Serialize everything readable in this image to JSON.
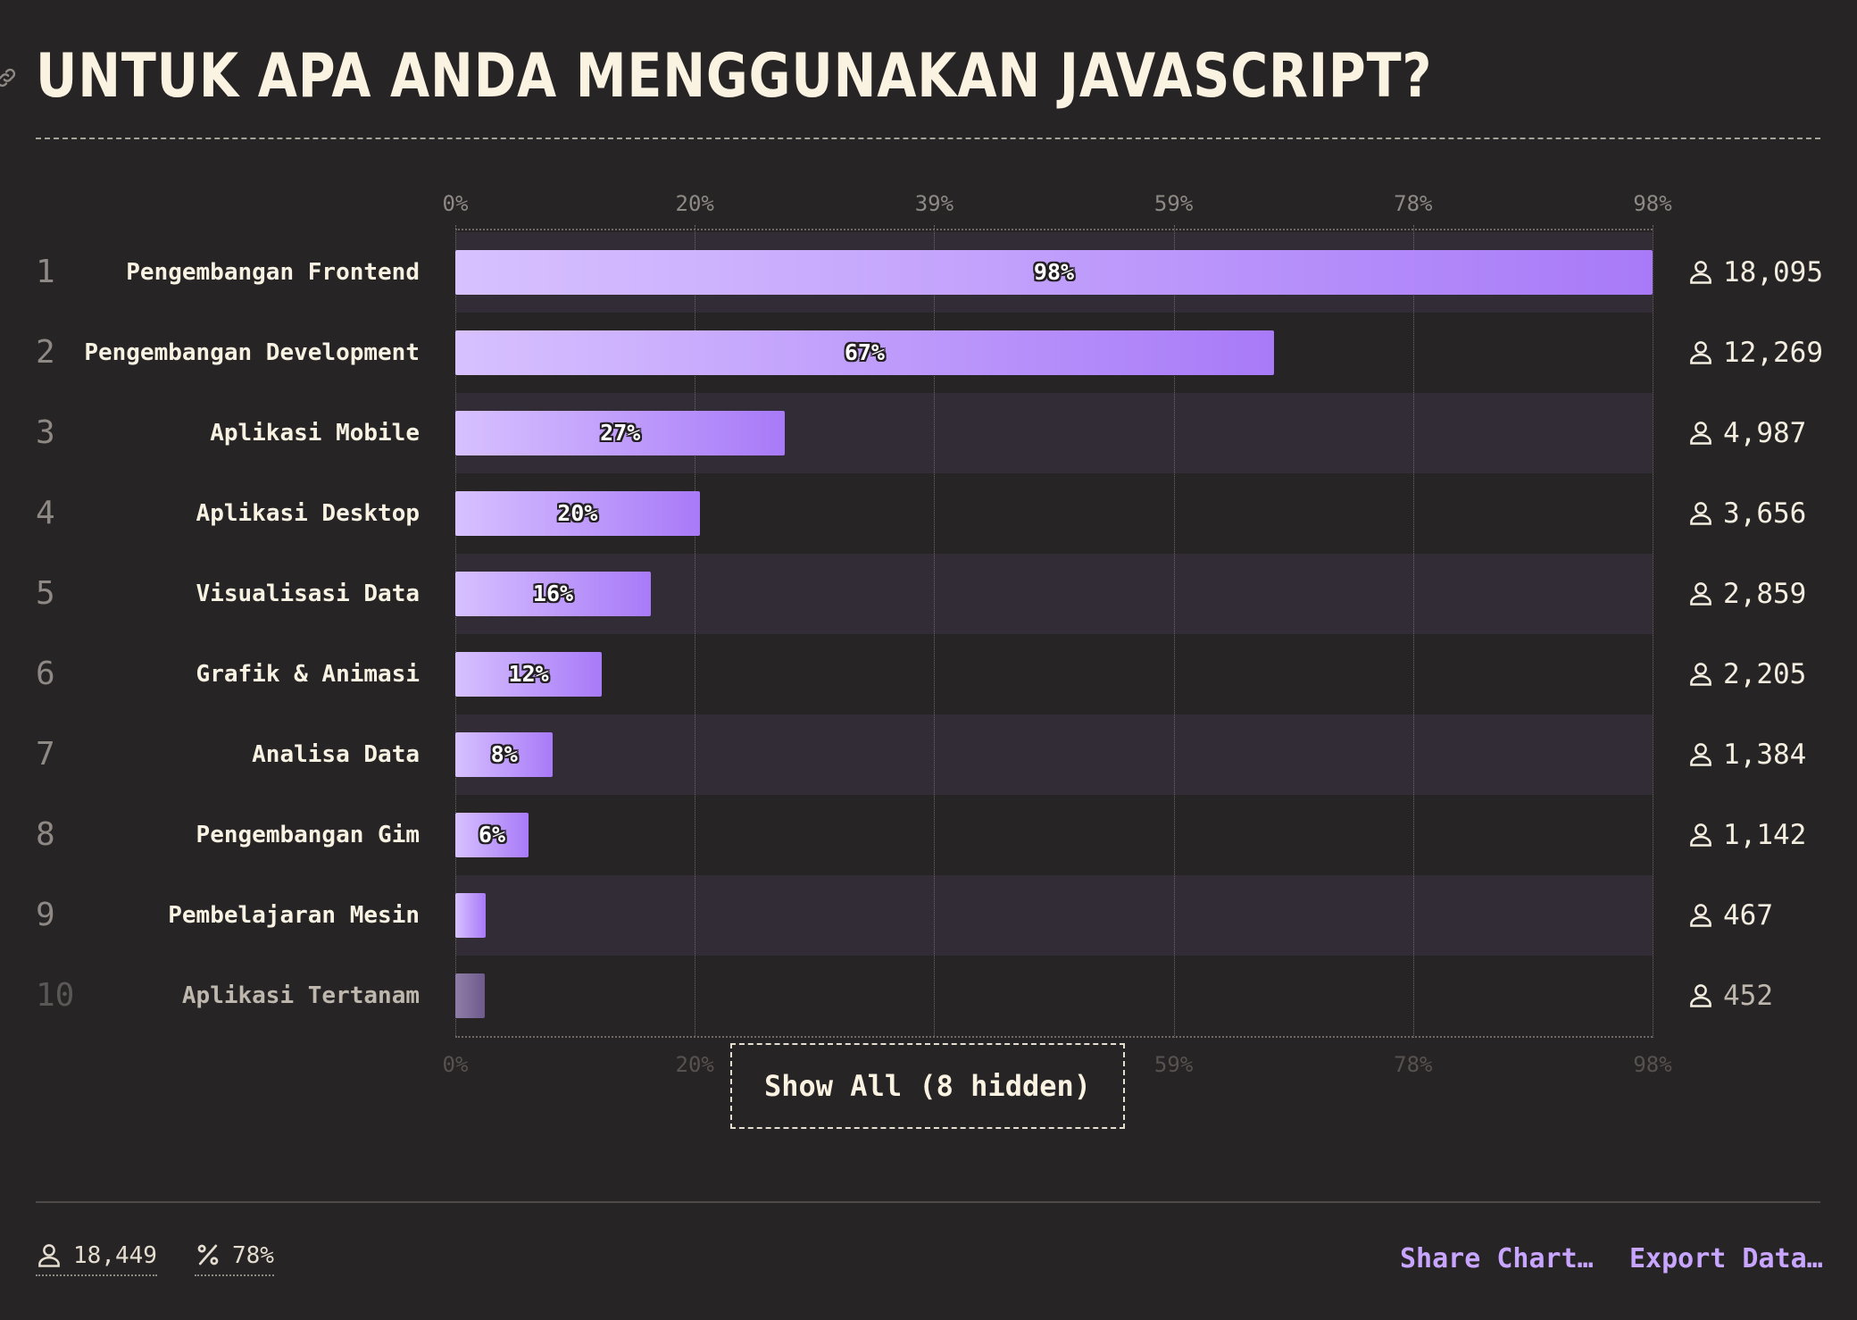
{
  "title": "UNTUK APA ANDA MENGGUNAKAN JAVASCRIPT?",
  "colors": {
    "background": "#272425",
    "bar_start": "#d7c1ff",
    "bar_end": "#a87af8",
    "accent": "#c8a6ff"
  },
  "chart_data": {
    "type": "bar",
    "orientation": "horizontal",
    "axis_ticks": [
      "0%",
      "20%",
      "39%",
      "59%",
      "78%",
      "98%"
    ],
    "xlim": [
      0,
      98
    ],
    "grid": true,
    "ranks": [
      "1",
      "2",
      "3",
      "4",
      "5",
      "6",
      "7",
      "8",
      "9",
      "10"
    ],
    "categories": [
      "Pengembangan Frontend",
      "Pengembangan Development",
      "Aplikasi Mobile",
      "Aplikasi Desktop",
      "Visualisasi Data",
      "Grafik & Animasi",
      "Analisa Data",
      "Pengembangan Gim",
      "Pembelajaran Mesin",
      "Aplikasi Tertanam"
    ],
    "values": [
      98,
      67,
      27,
      20,
      16,
      12,
      8,
      6,
      2.5,
      2.4
    ],
    "value_labels": [
      "98%",
      "67%",
      "27%",
      "20%",
      "16%",
      "12%",
      "8%",
      "6%",
      "",
      ""
    ],
    "counts": [
      "18,095",
      "12,269",
      "4,987",
      "3,656",
      "2,859",
      "2,205",
      "1,384",
      "1,142",
      "467",
      "452"
    ]
  },
  "show_all_label": "Show All (8 hidden)",
  "footer": {
    "respondents": "18,449",
    "percentage": "78%",
    "share_label": "Share Chart…",
    "export_label": "Export Data…"
  }
}
